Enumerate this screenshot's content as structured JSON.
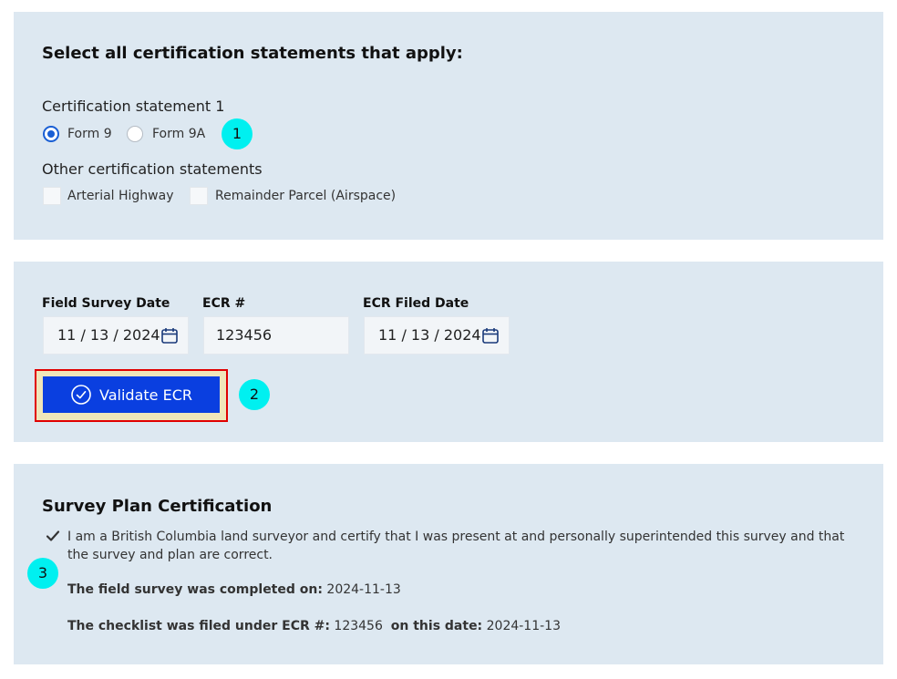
{
  "certification": {
    "heading": "Select all certification statements that apply:",
    "statement1_label": "Certification statement 1",
    "radio_options": [
      {
        "label": "Form 9",
        "selected": true
      },
      {
        "label": "Form 9A",
        "selected": false
      }
    ],
    "other_label": "Other certification statements",
    "checkboxes": [
      {
        "label": "Arterial Highway",
        "checked": false
      },
      {
        "label": "Remainder Parcel (Airspace)",
        "checked": false
      }
    ]
  },
  "survey": {
    "field_survey_date_label": "Field Survey Date",
    "field_survey_date_value": "11 / 13 / 2024",
    "ecr_label": "ECR #",
    "ecr_value": "123456",
    "ecr_filed_date_label": "ECR Filed Date",
    "ecr_filed_date_value": "11 / 13 / 2024",
    "validate_button_label": "Validate ECR"
  },
  "plan_certification": {
    "heading": "Survey Plan Certification",
    "checked": true,
    "statement_line1": "I am a British Columbia land surveyor and certify that I was present at and personally superintended this survey and that",
    "statement_line2": "the survey and plan are correct.",
    "completed_label": "The field survey was completed on:",
    "completed_value": "2024-11-13",
    "checklist_label": "The checklist was filed under ECR #:",
    "checklist_ecr": "123456",
    "on_date_label": "on this date:",
    "on_date_value": "2024-11-13"
  },
  "markers": [
    "1",
    "2",
    "3"
  ],
  "colors": {
    "accent": "#0a3fe0",
    "panel_bg": "#dde8f1",
    "marker": "#00f0f0",
    "highlight_border": "#e00000"
  },
  "icons": {
    "calendar": "calendar-icon",
    "check_circle": "check-circle-icon",
    "checkmark": "checkmark-icon"
  }
}
